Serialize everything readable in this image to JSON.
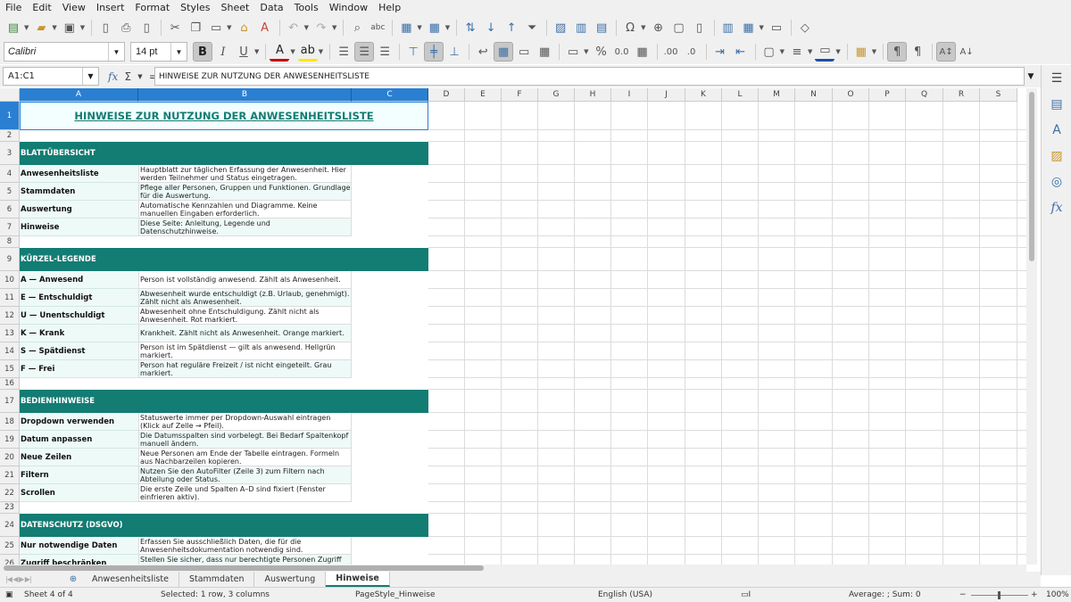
{
  "menu": [
    "File",
    "Edit",
    "View",
    "Insert",
    "Format",
    "Styles",
    "Sheet",
    "Data",
    "Tools",
    "Window",
    "Help"
  ],
  "toolbar": {
    "font_name": "Calibri",
    "font_size": "14 pt"
  },
  "formula": {
    "name_box": "A1:C1",
    "content": "HINWEISE ZUR NUTZUNG DER ANWESENHEITSLISTE"
  },
  "columns": [
    "A",
    "B",
    "C",
    "D",
    "E",
    "F",
    "G",
    "H",
    "I",
    "J",
    "K",
    "L",
    "M",
    "N",
    "O",
    "P",
    "Q",
    "R",
    "S"
  ],
  "sheet": {
    "title": "HINWEISE ZUR NUTZUNG DER ANWESENHEITSLISTE",
    "sections": [
      {
        "heading": "BLATTÜBERSICHT",
        "heading_row": "3",
        "rows": [
          {
            "row": "4",
            "label": "Anwesenheitsliste",
            "text": "Hauptblatt zur täglichen Erfassung der Anwesenheit. Hier werden Teilnehmer und Status eingetragen."
          },
          {
            "row": "5",
            "label": "Stammdaten",
            "text": "Pflege aller Personen, Gruppen und Funktionen. Grundlage für die Auswertung."
          },
          {
            "row": "6",
            "label": "Auswertung",
            "text": "Automatische Kennzahlen und Diagramme. Keine manuellen Eingaben erforderlich."
          },
          {
            "row": "7",
            "label": "Hinweise",
            "text": "Diese Seite: Anleitung, Legende und Datenschutzhinweise."
          }
        ]
      },
      {
        "heading": "KÜRZEL-LEGENDE",
        "heading_row": "9",
        "rows": [
          {
            "row": "10",
            "label": "A — Anwesend",
            "text": "Person ist vollständig anwesend. Zählt als Anwesenheit."
          },
          {
            "row": "11",
            "label": "E — Entschuldigt",
            "text": "Abwesenheit wurde entschuldigt (z.B. Urlaub, genehmigt). Zählt nicht als Anwesenheit."
          },
          {
            "row": "12",
            "label": "U — Unentschuldigt",
            "text": "Abwesenheit ohne Entschuldigung. Zählt nicht als Anwesenheit. Rot markiert."
          },
          {
            "row": "13",
            "label": "K — Krank",
            "text": "Krankheit. Zählt nicht als Anwesenheit. Orange markiert."
          },
          {
            "row": "14",
            "label": "S — Spätdienst",
            "text": "Person ist im Spätdienst — gilt als anwesend. Hellgrün markiert."
          },
          {
            "row": "15",
            "label": "F — Frei",
            "text": "Person hat reguläre Freizeit / ist nicht eingeteilt. Grau markiert."
          }
        ]
      },
      {
        "heading": "BEDIENHINWEISE",
        "heading_row": "17",
        "rows": [
          {
            "row": "18",
            "label": "Dropdown verwenden",
            "text": "Statuswerte immer per Dropdown-Auswahl eintragen (Klick auf Zelle → Pfeil)."
          },
          {
            "row": "19",
            "label": "Datum anpassen",
            "text": "Die Datumsspalten sind vorbelegt. Bei Bedarf Spaltenkopf manuell ändern."
          },
          {
            "row": "20",
            "label": "Neue Zeilen",
            "text": "Neue Personen am Ende der Tabelle eintragen. Formeln aus Nachbarzeilen kopieren."
          },
          {
            "row": "21",
            "label": "Filtern",
            "text": "Nutzen Sie den AutoFilter (Zeile 3) zum Filtern nach Abteilung oder Status."
          },
          {
            "row": "22",
            "label": "Scrollen",
            "text": "Die erste Zeile und Spalten A–D sind fixiert (Fenster einfrieren aktiv)."
          }
        ]
      },
      {
        "heading": "DATENSCHUTZ (DSGVO)",
        "heading_row": "24",
        "rows": [
          {
            "row": "25",
            "label": "Nur notwendige Daten",
            "text": "Erfassen Sie ausschließlich Daten, die für die Anwesenheitsdokumentation notwendig sind."
          },
          {
            "row": "26",
            "label": "Zugriff beschränken",
            "text": "Stellen Sie sicher, dass nur berechtigte Personen Zugriff auf diese"
          }
        ]
      }
    ],
    "empty_rows": [
      "2",
      "8",
      "16",
      "23"
    ]
  },
  "tabs": [
    "Anwesenheitsliste",
    "Stammdaten",
    "Auswertung",
    "Hinweise"
  ],
  "active_tab": "Hinweise",
  "status": {
    "sheet": "Sheet 4 of 4",
    "selection": "Selected: 1 row, 3 columns",
    "page_style": "PageStyle_Hinweise",
    "language": "English (USA)",
    "sum": "Average: ; Sum: 0",
    "zoom": "100%"
  },
  "colors": {
    "band": "#137c73",
    "label_bg": "#eefaf8",
    "selection": "#2a7fd2"
  }
}
